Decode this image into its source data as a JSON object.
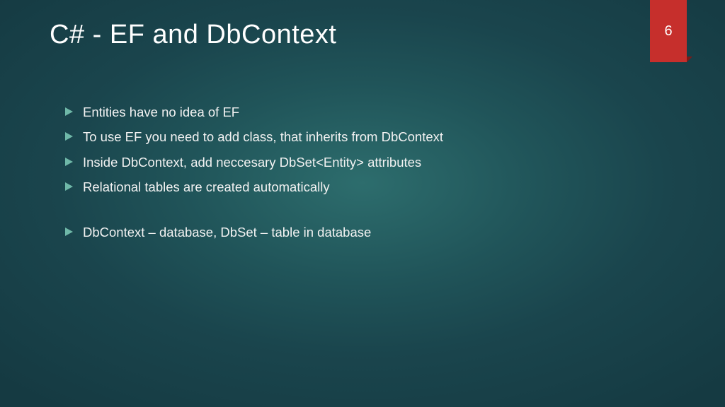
{
  "slide": {
    "title": "C# - EF and DbContext",
    "page_number": "6",
    "accent_color": "#c62f2c",
    "bullets_group1": [
      "Entities have no idea of EF",
      "To use EF you need to add class, that inherits from DbContext",
      "Inside DbContext, add neccesary DbSet<Entity> attributes",
      "Relational tables are created automatically"
    ],
    "bullets_group2": [
      "DbContext – database, DbSet – table in database"
    ]
  }
}
